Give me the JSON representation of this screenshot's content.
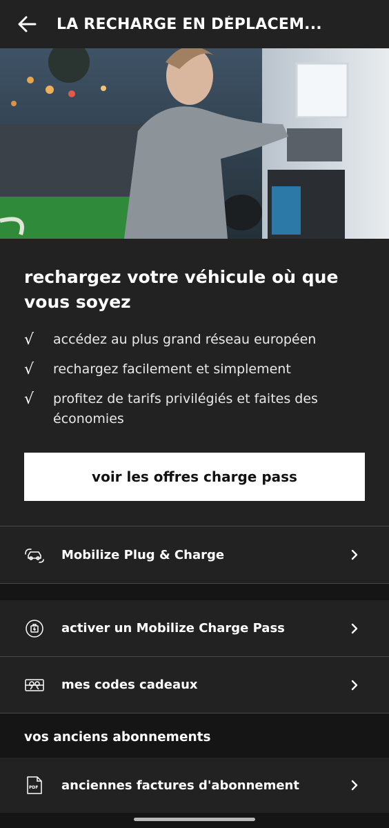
{
  "app_bar": {
    "title": "LA RECHARGE EN DÉPLACEM..."
  },
  "promo": {
    "heading": "rechargez votre véhicule où que vous soyez",
    "check_glyph": "√",
    "benefits": [
      "accédez au plus grand réseau européen",
      "rechargez facilement et simplement",
      "profitez de tarifs privilégiés et faites des économies"
    ],
    "cta_label": "voir les offres charge pass"
  },
  "rows": {
    "plug_charge": {
      "label": "Mobilize Plug & Charge",
      "icon": "car-plug-icon"
    },
    "activate_pass": {
      "label": "activer un Mobilize Charge Pass",
      "icon": "charge-pass-icon"
    },
    "gift_codes": {
      "label": "mes codes cadeaux",
      "icon": "gift-card-icon"
    },
    "old_invoices": {
      "label": "anciennes factures d'abonnement",
      "icon": "pdf-file-icon"
    }
  },
  "sections": {
    "old_subscriptions_title": "vos anciens abonnements"
  },
  "colors": {
    "background": "#151515",
    "surface": "#222222",
    "divider": "#4a4a4a",
    "cta_bg": "#ffffff",
    "cta_text": "#111111"
  }
}
